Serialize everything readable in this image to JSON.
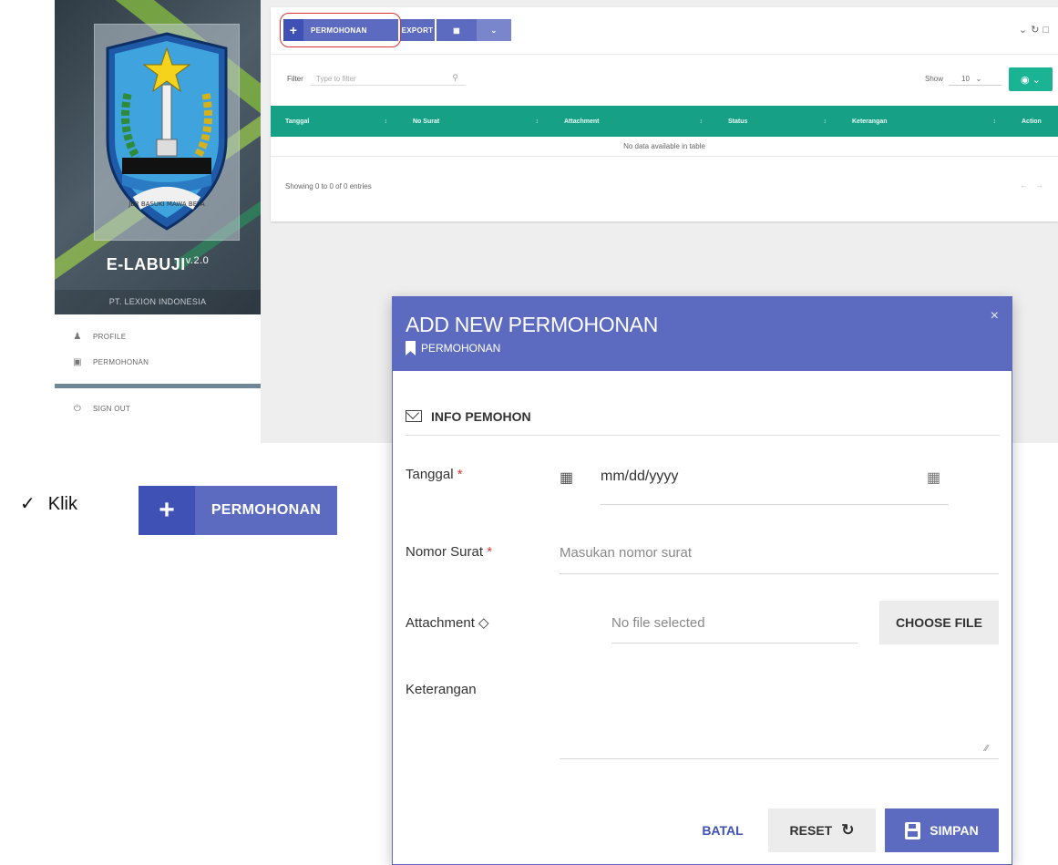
{
  "sidebar": {
    "brand_title": "E-LABUJI",
    "brand_version": "v.2.0",
    "brand_subtitle": "PT. LEXION INDONESIA",
    "logo_motto": "JER BASUKI MAWA BEYA",
    "items": [
      {
        "label": "PROFILE",
        "icon": "user-icon"
      },
      {
        "label": "PERMOHONAN",
        "icon": "inbox-icon"
      },
      {
        "label": "SIGN OUT",
        "icon": "power-icon"
      }
    ]
  },
  "toolbar": {
    "add_label": "PERMOHONAN",
    "export_label": "EXPORT"
  },
  "filter": {
    "label": "Filter",
    "placeholder": "Type to filter",
    "show_label": "Show",
    "show_value": "10"
  },
  "table": {
    "columns": [
      "Tanggal",
      "No Surat",
      "Attachment",
      "Status",
      "Keterangan",
      "Action"
    ],
    "empty_message": "No data available in table",
    "info": "Showing 0 to 0 of 0 entries"
  },
  "instruction": {
    "prefix": "Klik",
    "button_label": "PERMOHONAN"
  },
  "modal": {
    "title": "ADD NEW PERMOHONAN",
    "subtitle": "PERMOHONAN",
    "close": "×",
    "section_title": "INFO PEMOHON",
    "fields": {
      "tanggal_label": "Tanggal",
      "tanggal_value": "mm/dd/yyyy",
      "nomor_label": "Nomor Surat",
      "nomor_placeholder": "Masukan nomor surat",
      "attachment_label": "Attachment",
      "attachment_value": "No file selected",
      "choose_label": "CHOOSE FILE",
      "keterangan_label": "Keterangan"
    },
    "required_mark": "*",
    "buttons": {
      "batal": "BATAL",
      "reset": "RESET",
      "simpan": "SIMPAN"
    }
  },
  "colors": {
    "primary": "#5c6bc0",
    "primary_dark": "#3f51b5",
    "table_header": "#16a085",
    "accent_green": "#1ab394",
    "required": "#e53935",
    "highlight_ring": "#d9343b"
  }
}
